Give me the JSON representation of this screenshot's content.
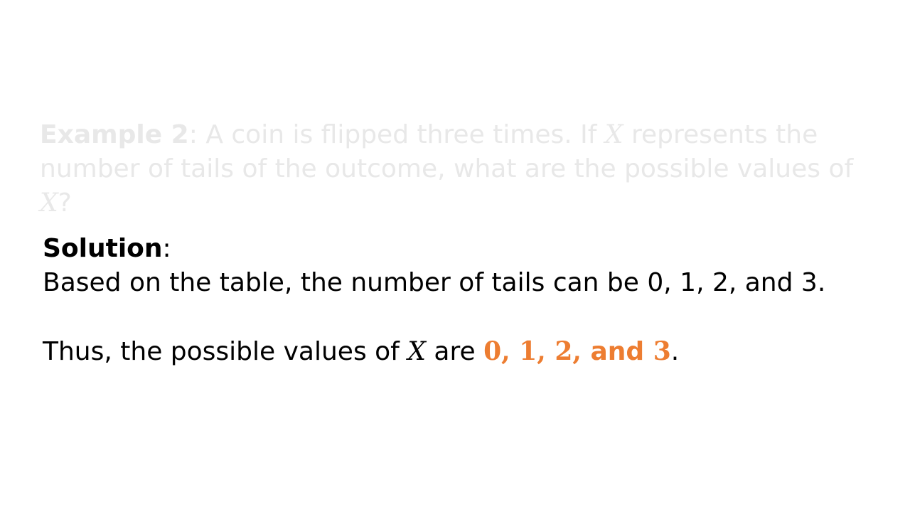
{
  "problem": {
    "label": "Example 2",
    "sep": ": ",
    "text_1": "A coin is flipped three times. If ",
    "var_1": "X",
    "text_2": " represents the number of tails of the outcome, what are the possible values of ",
    "var_2": "X",
    "text_3": "?"
  },
  "solution": {
    "label": "Solution",
    "sep": ":",
    "line_1": "Based on the table, the number of tails can be 0, 1, 2, and 3.",
    "line_2_prefix": "Thus, the possible values of ",
    "line_2_var": "X",
    "line_2_mid": " are ",
    "answer": {
      "v0": "0",
      "c0": ", ",
      "v1": "1",
      "c1": ", ",
      "v2": "2",
      "c2": ", ",
      "and": "and ",
      "v3": "3"
    },
    "line_2_end": "."
  },
  "colors": {
    "faded_text": "#e8e8e8",
    "main_text": "#000000",
    "accent": "#ed7d31"
  }
}
